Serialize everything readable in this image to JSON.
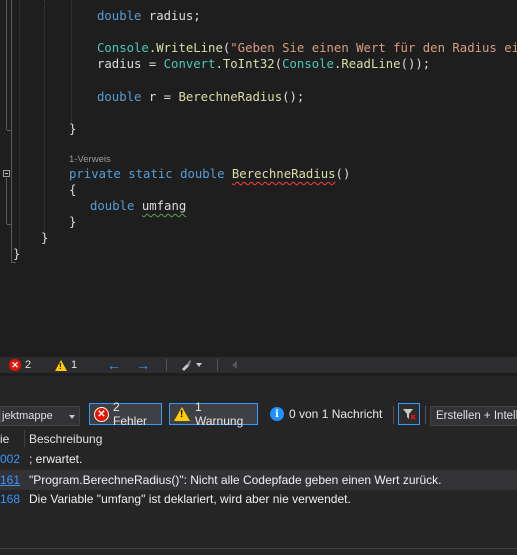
{
  "editor": {
    "lines": [
      {
        "id": "l1",
        "tokens": [
          {
            "t": "double",
            "c": "kw"
          },
          {
            "t": " radius;",
            "c": "plain"
          }
        ]
      },
      {
        "id": "l2",
        "tokens": [
          {
            "t": "Console",
            "c": "type"
          },
          {
            "t": ".",
            "c": "plain"
          },
          {
            "t": "WriteLine",
            "c": "method"
          },
          {
            "t": "(",
            "c": "plain"
          },
          {
            "t": "\"Geben Sie einen Wert für den Radius ein\"",
            "c": "str"
          },
          {
            "t": ")",
            "c": "plain"
          }
        ]
      },
      {
        "id": "l3",
        "tokens": [
          {
            "t": "radius = ",
            "c": "plain"
          },
          {
            "t": "Convert",
            "c": "type"
          },
          {
            "t": ".",
            "c": "plain"
          },
          {
            "t": "ToInt32",
            "c": "method"
          },
          {
            "t": "(",
            "c": "plain"
          },
          {
            "t": "Console",
            "c": "type"
          },
          {
            "t": ".",
            "c": "plain"
          },
          {
            "t": "ReadLine",
            "c": "method"
          },
          {
            "t": "());",
            "c": "plain"
          }
        ]
      },
      {
        "id": "l4",
        "tokens": [
          {
            "t": "double",
            "c": "kw"
          },
          {
            "t": " r = ",
            "c": "plain"
          },
          {
            "t": "BerechneRadius",
            "c": "method"
          },
          {
            "t": "();",
            "c": "plain"
          }
        ]
      },
      {
        "id": "l5",
        "tokens": [
          {
            "t": "}",
            "c": "plain"
          }
        ]
      },
      {
        "id": "l6",
        "tokens": [
          {
            "t": "private",
            "c": "kw"
          },
          {
            "t": " ",
            "c": "plain"
          },
          {
            "t": "static",
            "c": "kw"
          },
          {
            "t": " ",
            "c": "plain"
          },
          {
            "t": "double",
            "c": "kw"
          },
          {
            "t": " ",
            "c": "plain"
          },
          {
            "t": "BerechneRadius",
            "c": "method squiggle-red"
          },
          {
            "t": "()",
            "c": "plain"
          }
        ]
      },
      {
        "id": "l7",
        "tokens": [
          {
            "t": "{",
            "c": "plain"
          }
        ]
      },
      {
        "id": "l8",
        "tokens": [
          {
            "t": "double",
            "c": "kw"
          },
          {
            "t": " ",
            "c": "plain"
          },
          {
            "t": "umfang",
            "c": "plain squiggle-green"
          },
          {
            "t": "",
            "c": "squiggle-tail"
          }
        ]
      },
      {
        "id": "l9",
        "tokens": [
          {
            "t": "}",
            "c": "plain"
          }
        ]
      },
      {
        "id": "l10",
        "tokens": [
          {
            "t": "}",
            "c": "plain"
          }
        ]
      },
      {
        "id": "l11",
        "tokens": [
          {
            "t": "}",
            "c": "plain"
          }
        ]
      }
    ],
    "codelens": "1-Verweis"
  },
  "status_strip": {
    "error_count": "2",
    "warning_count": "1"
  },
  "error_list": {
    "scope_combo": "jektmappe",
    "errors_button": "2 Fehler",
    "warnings_button": "1 Warnung",
    "messages_button": "0 von 1 Nachricht",
    "build_combo": "Erstellen + IntelliSense",
    "columns": {
      "code": "ie",
      "description": "Beschreibung"
    },
    "rows": [
      {
        "code": "002",
        "description": "; erwartet."
      },
      {
        "code": "161",
        "description": "\"Program.BerechneRadius()\": Nicht alle Codepfade geben einen Wert zurück."
      },
      {
        "code": "168",
        "description": "Die Variable \"umfang\" ist deklariert, wird aber nie verwendet."
      }
    ]
  },
  "colors": {
    "error": "#e51400",
    "warning": "#ffcc00",
    "link": "#3794ff",
    "keyword": "#569cd6",
    "method": "#dcdcaa",
    "type": "#4ec9b0",
    "string": "#d69d85"
  }
}
